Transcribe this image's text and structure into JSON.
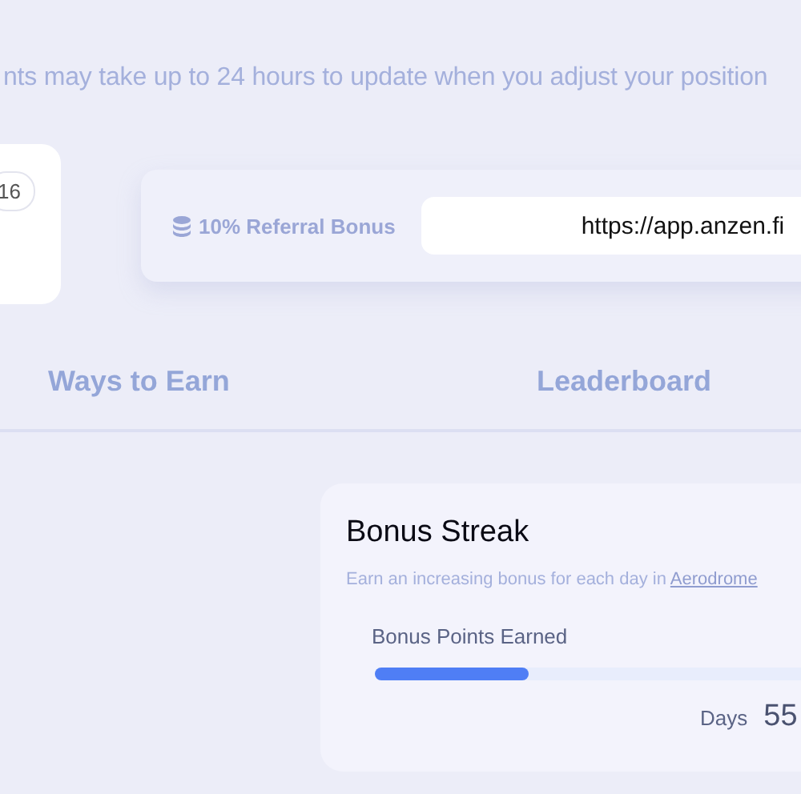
{
  "notice": "nts may take up to 24 hours to update when you adjust your position",
  "rank_card": {
    "badge": "16"
  },
  "referral": {
    "label": "10% Referral Bonus",
    "link": "https://app.anzen.fi"
  },
  "tabs": [
    {
      "label": "Ways to Earn",
      "selected": false
    },
    {
      "label": "Leaderboard",
      "selected": false
    }
  ],
  "bonus_streak": {
    "title": "Bonus Streak",
    "description": "Earn an increasing bonus for each day in",
    "link": "Aerodrome",
    "progress_label": "Bonus Points Earned",
    "level": 0.33,
    "days_label": "Days",
    "days": "55"
  }
}
